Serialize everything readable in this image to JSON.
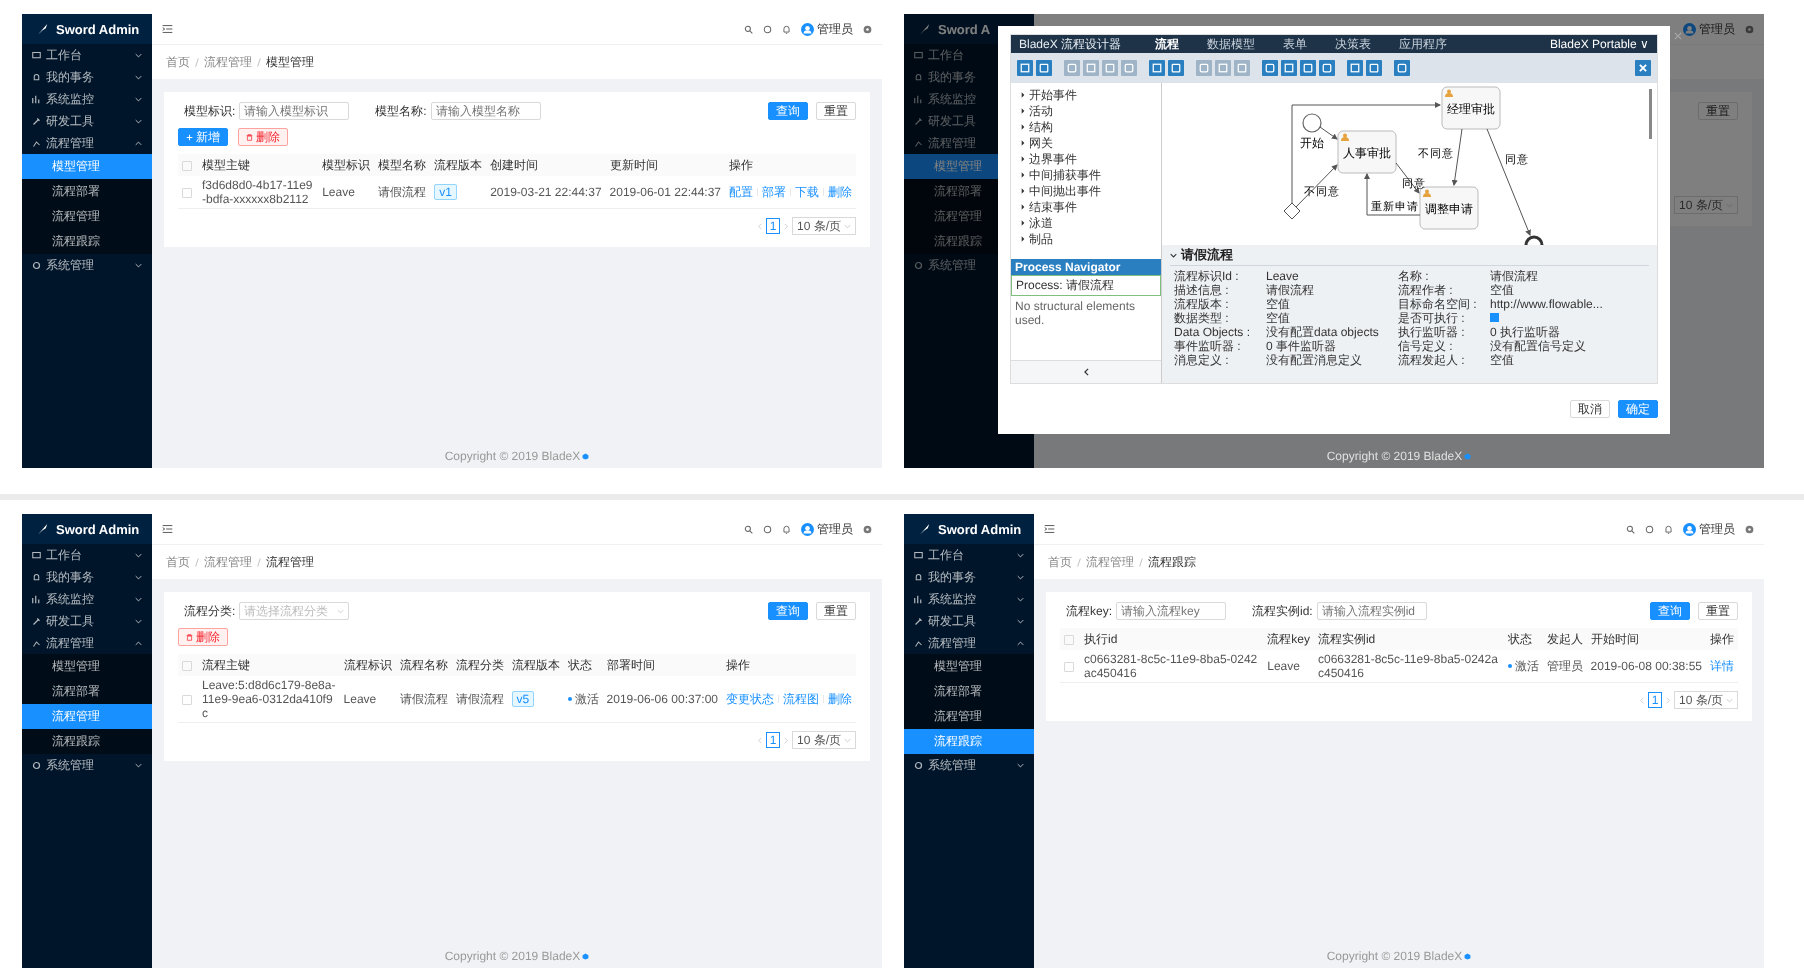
{
  "screens": [
    {
      "kind": "list",
      "sidebar": {
        "logo": "Sword Admin",
        "items": [
          {
            "label": "工作台",
            "expanded": false
          },
          {
            "label": "我的事务",
            "expanded": false
          },
          {
            "label": "系统监控",
            "expanded": false
          },
          {
            "label": "研发工具",
            "expanded": false
          },
          {
            "label": "流程管理",
            "expanded": true,
            "children": [
              {
                "label": "模型管理",
                "selected": true
              },
              {
                "label": "流程部署",
                "selected": false
              },
              {
                "label": "流程管理",
                "selected": false
              },
              {
                "label": "流程跟踪",
                "selected": false
              }
            ]
          },
          {
            "label": "系统管理",
            "expanded": false
          }
        ]
      },
      "header": {
        "user": "管理员"
      },
      "breadcrumb": [
        "首页",
        "流程管理",
        "模型管理"
      ],
      "filters": [
        {
          "kind": "input",
          "label": "模型标识:",
          "placeholder": "请输入模型标识"
        },
        {
          "kind": "input",
          "label": "模型名称:",
          "placeholder": "请输入模型名称"
        }
      ],
      "search_buttons": [
        {
          "label": "查询",
          "kind": "primary"
        },
        {
          "label": "重置",
          "kind": "default"
        }
      ],
      "toolbar": [
        {
          "label": "新增",
          "kind": "primary"
        },
        {
          "label": "删除",
          "kind": "danger"
        }
      ],
      "table": {
        "all_selected": false,
        "columns": [
          "模型主键",
          "模型标识",
          "模型名称",
          "流程版本",
          "创建时间",
          "更新时间",
          "操作"
        ],
        "rows": [
          {
            "selected": false,
            "cells": [
              {
                "kind": "text",
                "text": "f3d6d8d0-4b17-11e9-bdfa-xxxxxx8b2112"
              },
              {
                "kind": "text",
                "text": "Leave"
              },
              {
                "kind": "text",
                "text": "请假流程"
              },
              {
                "kind": "tag",
                "text": "v1"
              },
              {
                "kind": "text",
                "text": "2019-03-21 22:44:37"
              },
              {
                "kind": "text",
                "text": "2019-06-01 22:44:37"
              },
              {
                "kind": "links",
                "links": [
                  "配置",
                  "部署",
                  "下载",
                  "删除"
                ]
              }
            ]
          }
        ]
      },
      "pagination": {
        "pages": [
          {
            "label": "1",
            "selected": true
          }
        ],
        "page_size": "10 条/页"
      },
      "footer": "Copyright © 2019 BladeX"
    },
    {
      "kind": "designer",
      "sidebar": {
        "logo": "Sword A",
        "items": [
          {
            "label": "工作台"
          },
          {
            "label": "我的事务"
          },
          {
            "label": "系统监控"
          },
          {
            "label": "研发工具"
          },
          {
            "label": "流程管理",
            "children": [
              {
                "label": "模型管理",
                "selected": true
              },
              {
                "label": "流程部署",
                "selected": false
              },
              {
                "label": "流程管理",
                "selected": false
              },
              {
                "label": "流程跟踪",
                "selected": false
              }
            ]
          },
          {
            "label": "系统管理"
          }
        ]
      },
      "header": {
        "user": "管理员"
      },
      "side_button": "重置",
      "page_size": "10 条/页",
      "footer": "Copyright © 2019 BladeX",
      "dialog": {
        "title": "BladeX 流程设计器",
        "tabs": [
          {
            "label": "流程",
            "selected": true
          },
          {
            "label": "数据模型",
            "selected": false
          },
          {
            "label": "表单",
            "selected": false
          },
          {
            "label": "决策表",
            "selected": false
          },
          {
            "label": "应用程序",
            "selected": false
          }
        ],
        "account": "BladeX Portable ∨",
        "tools": [
          {
            "disabled": false
          },
          {
            "disabled": false
          },
          {
            "disabled": true
          },
          {
            "disabled": true
          },
          {
            "disabled": true
          },
          {
            "disabled": true
          },
          {
            "disabled": false
          },
          {
            "disabled": false
          },
          {
            "disabled": true
          },
          {
            "disabled": true
          },
          {
            "disabled": true
          },
          {
            "disabled": false
          },
          {
            "disabled": false
          },
          {
            "disabled": false
          },
          {
            "disabled": false
          },
          {
            "disabled": false
          },
          {
            "disabled": false
          },
          {
            "disabled": false
          }
        ],
        "palette": [
          "开始事件",
          "活动",
          "结构",
          "网关",
          "边界事件",
          "中间捕获事件",
          "中间抛出事件",
          "结束事件",
          "泳道",
          "制品"
        ],
        "navigator": {
          "title": "Process Navigator",
          "process": "Process: 请假流程",
          "note": "No structural elements used."
        },
        "diagram": {
          "start": "开始",
          "nodes": [
            "人事审批",
            "经理审批",
            "调整申请"
          ],
          "edges": [
            "同意",
            "不同意",
            "重新申请",
            "同意",
            "不同意"
          ]
        },
        "properties": {
          "title": "请假流程",
          "items": [
            {
              "kind": "text",
              "label": "流程标识Id :",
              "value": "Leave"
            },
            {
              "kind": "text",
              "label": "名称 :",
              "value": "请假流程"
            },
            {
              "kind": "text",
              "label": "描述信息 :",
              "value": "请假流程"
            },
            {
              "kind": "text",
              "label": "流程作者 :",
              "value": "空值"
            },
            {
              "kind": "text",
              "label": "流程版本 :",
              "value": "空值"
            },
            {
              "kind": "text",
              "label": "目标命名空间 :",
              "value": "http://www.flowable..."
            },
            {
              "kind": "text",
              "label": "数据类型 :",
              "value": "空值"
            },
            {
              "kind": "checkbox",
              "label": "是否可执行 :",
              "checked": true
            },
            {
              "kind": "text",
              "label": "Data Objects :",
              "value": "没有配置data objects"
            },
            {
              "kind": "text",
              "label": "执行监听器 :",
              "value": "0 执行监听器"
            },
            {
              "kind": "text",
              "label": "事件监听器 :",
              "value": "0 事件监听器"
            },
            {
              "kind": "text",
              "label": "信号定义 :",
              "value": "没有配置信号定义"
            },
            {
              "kind": "text",
              "label": "消息定义 :",
              "value": "没有配置消息定义"
            },
            {
              "kind": "text",
              "label": "流程发起人 :",
              "value": "空值"
            }
          ]
        },
        "buttons": [
          {
            "label": "取消",
            "kind": "default"
          },
          {
            "label": "确定",
            "kind": "primary"
          }
        ]
      }
    },
    {
      "kind": "list",
      "sidebar": {
        "logo": "Sword Admin",
        "items": [
          {
            "label": "工作台",
            "expanded": false
          },
          {
            "label": "我的事务",
            "expanded": false
          },
          {
            "label": "系统监控",
            "expanded": false
          },
          {
            "label": "研发工具",
            "expanded": false
          },
          {
            "label": "流程管理",
            "expanded": true,
            "children": [
              {
                "label": "模型管理",
                "selected": false
              },
              {
                "label": "流程部署",
                "selected": false
              },
              {
                "label": "流程管理",
                "selected": true
              },
              {
                "label": "流程跟踪",
                "selected": false
              }
            ]
          },
          {
            "label": "系统管理",
            "expanded": false
          }
        ]
      },
      "header": {
        "user": "管理员"
      },
      "breadcrumb": [
        "首页",
        "流程管理",
        "流程管理"
      ],
      "filters": [
        {
          "kind": "select",
          "label": "流程分类:",
          "placeholder": "请选择流程分类"
        }
      ],
      "search_buttons": [
        {
          "label": "查询",
          "kind": "primary"
        },
        {
          "label": "重置",
          "kind": "default"
        }
      ],
      "toolbar": [
        {
          "label": "删除",
          "kind": "danger"
        }
      ],
      "table": {
        "all_selected": false,
        "columns": [
          "流程主键",
          "流程标识",
          "流程名称",
          "流程分类",
          "流程版本",
          "状态",
          "部署时间",
          "操作"
        ],
        "rows": [
          {
            "selected": false,
            "cells": [
              {
                "kind": "text",
                "text": "Leave:5:d8d6c179-8e8a-11e9-9ea6-0312da410f9c"
              },
              {
                "kind": "text",
                "text": "Leave"
              },
              {
                "kind": "text",
                "text": "请假流程"
              },
              {
                "kind": "text",
                "text": "请假流程"
              },
              {
                "kind": "tag",
                "text": "v5"
              },
              {
                "kind": "status",
                "text": "激活",
                "color": "#1890ff"
              },
              {
                "kind": "text",
                "text": "2019-06-06 00:37:00"
              },
              {
                "kind": "links",
                "links": [
                  "变更状态",
                  "流程图",
                  "删除"
                ]
              }
            ]
          }
        ]
      },
      "pagination": {
        "pages": [
          {
            "label": "1",
            "selected": true
          }
        ],
        "page_size": "10 条/页"
      },
      "footer": "Copyright © 2019 BladeX"
    },
    {
      "kind": "list",
      "sidebar": {
        "logo": "Sword Admin",
        "items": [
          {
            "label": "工作台",
            "expanded": false
          },
          {
            "label": "我的事务",
            "expanded": false
          },
          {
            "label": "系统监控",
            "expanded": false
          },
          {
            "label": "研发工具",
            "expanded": false
          },
          {
            "label": "流程管理",
            "expanded": true,
            "children": [
              {
                "label": "模型管理",
                "selected": false
              },
              {
                "label": "流程部署",
                "selected": false
              },
              {
                "label": "流程管理",
                "selected": false
              },
              {
                "label": "流程跟踪",
                "selected": true
              }
            ]
          },
          {
            "label": "系统管理",
            "expanded": false
          }
        ]
      },
      "header": {
        "user": "管理员"
      },
      "breadcrumb": [
        "首页",
        "流程管理",
        "流程跟踪"
      ],
      "filters": [
        {
          "kind": "input",
          "label": "流程key:",
          "placeholder": "请输入流程key"
        },
        {
          "kind": "input",
          "label": "流程实例id:",
          "placeholder": "请输入流程实例id"
        }
      ],
      "search_buttons": [
        {
          "label": "查询",
          "kind": "primary"
        },
        {
          "label": "重置",
          "kind": "default"
        }
      ],
      "table": {
        "all_selected": false,
        "columns": [
          "执行id",
          "流程key",
          "流程实例id",
          "状态",
          "发起人",
          "开始时间",
          "操作"
        ],
        "rows": [
          {
            "selected": false,
            "cells": [
              {
                "kind": "text",
                "text": "c0663281-8c5c-11e9-8ba5-0242ac450416"
              },
              {
                "kind": "text",
                "text": "Leave"
              },
              {
                "kind": "text",
                "text": "c0663281-8c5c-11e9-8ba5-0242ac450416"
              },
              {
                "kind": "status",
                "text": "激活",
                "color": "#1890ff"
              },
              {
                "kind": "text",
                "text": "管理员"
              },
              {
                "kind": "text",
                "text": "2019-06-08 00:38:55"
              },
              {
                "kind": "links",
                "links": [
                  "详情"
                ]
              }
            ]
          }
        ]
      },
      "pagination": {
        "pages": [
          {
            "label": "1",
            "selected": true
          }
        ],
        "page_size": "10 条/页"
      },
      "footer": "Copyright © 2019 BladeX"
    }
  ]
}
